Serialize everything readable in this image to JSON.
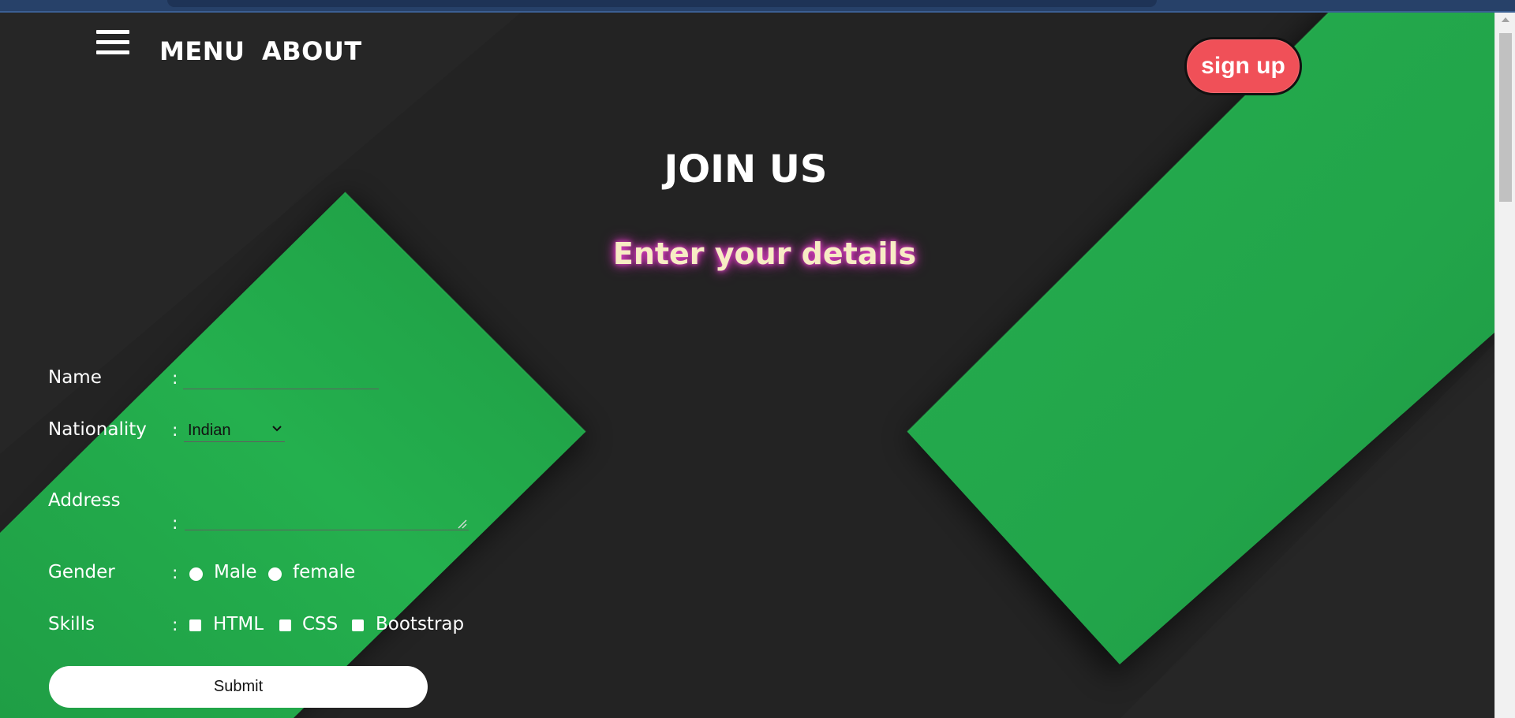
{
  "nav": {
    "menu_label": "MENU",
    "about_label": "ABOUT",
    "signup_label": "sign up"
  },
  "hero": {
    "title": "JOIN US",
    "subtitle": "Enter your details"
  },
  "form": {
    "colon": ":",
    "name": {
      "label": "Name",
      "value": ""
    },
    "nationality": {
      "label": "Nationality",
      "selected": "Indian"
    },
    "address": {
      "label": "Address",
      "value": ""
    },
    "gender": {
      "label": "Gender",
      "options": [
        "Male",
        "female"
      ]
    },
    "skills": {
      "label": "Skills",
      "options": [
        "HTML",
        "CSS",
        "Bootstrap"
      ]
    },
    "submit_label": "Submit"
  },
  "colors": {
    "background": "#232323",
    "accent_green": "#22a94c",
    "signup_red": "#f05058",
    "subtitle_text": "#f7ecc4",
    "subtitle_glow": "#e040c8",
    "browser_bar": "#274169"
  },
  "icons": {
    "menu": "hamburger-icon",
    "dropdown": "chevron-down-icon",
    "resize": "resize-grip-icon"
  }
}
